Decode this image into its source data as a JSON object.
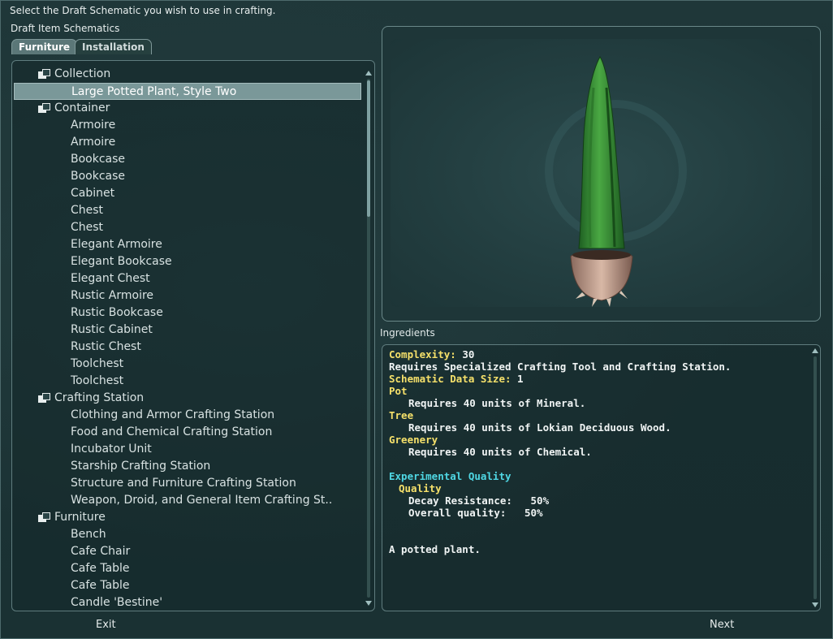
{
  "header": {
    "instruction": "Select the Draft Schematic you wish to use in crafting.",
    "section_title": "Draft Item Schematics"
  },
  "tabs": [
    {
      "label": "Furniture",
      "active": true
    },
    {
      "label": "Installation",
      "active": false
    }
  ],
  "tree": {
    "categories": [
      {
        "label": "Collection",
        "items": [
          "Large Potted Plant, Style Two"
        ]
      },
      {
        "label": "Container",
        "items": [
          "Armoire",
          "Armoire",
          "Bookcase",
          "Bookcase",
          "Cabinet",
          "Chest",
          "Chest",
          "Elegant Armoire",
          "Elegant Bookcase",
          "Elegant Chest",
          "Rustic Armoire",
          "Rustic Bookcase",
          "Rustic Cabinet",
          "Rustic Chest",
          "Toolchest",
          "Toolchest"
        ]
      },
      {
        "label": "Crafting Station",
        "items": [
          "Clothing and Armor Crafting Station",
          "Food and Chemical Crafting Station",
          "Incubator Unit",
          "Starship Crafting Station",
          "Structure and Furniture Crafting Station",
          "Weapon, Droid, and General Item Crafting St.."
        ]
      },
      {
        "label": "Furniture",
        "items": [
          "Bench",
          "Cafe Chair",
          "Cafe Table",
          "Cafe Table",
          "Candle 'Bestine'"
        ]
      }
    ],
    "selected_item": "Large Potted Plant, Style Two",
    "icons": {
      "category": "folder-icon"
    }
  },
  "ingredients": {
    "label": "Ingredients",
    "complexity_label": "Complexity:",
    "complexity_value": "30",
    "requirement": "Requires Specialized Crafting Tool and Crafting Station.",
    "data_size_label": "Schematic Data Size:",
    "data_size_value": "1",
    "slots": [
      {
        "name": "Pot",
        "desc": "Requires 40 units of Mineral."
      },
      {
        "name": "Tree",
        "desc": "Requires 40 units of Lokian Deciduous Wood."
      },
      {
        "name": "Greenery",
        "desc": "Requires 40 units of Chemical."
      }
    ],
    "exp_title": "Experimental Quality",
    "exp_group": "Quality",
    "exp_attrs": [
      {
        "label": "Decay Resistance:",
        "value": "50%"
      },
      {
        "label": "Overall quality:",
        "value": "50%"
      }
    ],
    "description": "A potted plant."
  },
  "footer": {
    "exit_label": "Exit",
    "next_label": "Next"
  },
  "colors": {
    "highlight_yellow": "#f5e06a",
    "accent_cyan": "#4fd7e4",
    "selection": "#7a9899",
    "background": "#1c3436"
  }
}
